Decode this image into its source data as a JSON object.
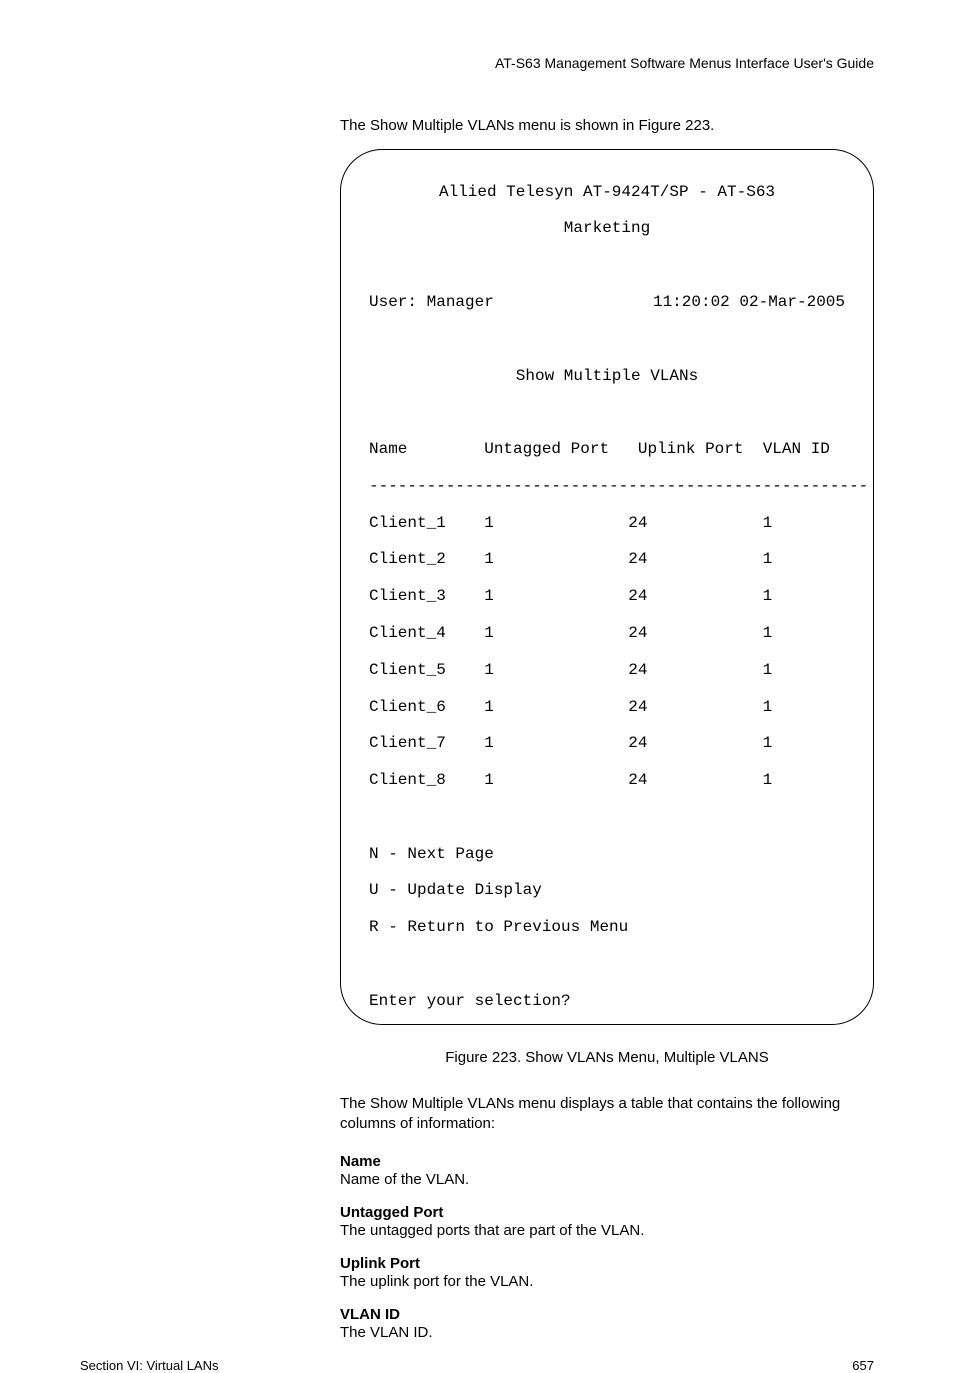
{
  "header": "AT-S63 Management Software Menus Interface User's Guide",
  "intro": "The Show Multiple VLANs menu is shown in Figure 223.",
  "terminal": {
    "title1": "Allied Telesyn AT-9424T/SP - AT-S63",
    "title2": "Marketing",
    "user_label": "User: Manager",
    "timestamp": "11:20:02 02-Mar-2005",
    "screen_title": "Show Multiple VLANs",
    "col_name": "Name",
    "col_untagged": "Untagged Port",
    "col_uplink": "Uplink Port",
    "col_vlan": "VLAN ID",
    "divider": "----------------------------------------------------",
    "rows": [
      {
        "name": "Client_1",
        "untagged": "1",
        "uplink": "24",
        "vlan": "1"
      },
      {
        "name": "Client_2",
        "untagged": "1",
        "uplink": "24",
        "vlan": "1"
      },
      {
        "name": "Client_3",
        "untagged": "1",
        "uplink": "24",
        "vlan": "1"
      },
      {
        "name": "Client_4",
        "untagged": "1",
        "uplink": "24",
        "vlan": "1"
      },
      {
        "name": "Client_5",
        "untagged": "1",
        "uplink": "24",
        "vlan": "1"
      },
      {
        "name": "Client_6",
        "untagged": "1",
        "uplink": "24",
        "vlan": "1"
      },
      {
        "name": "Client_7",
        "untagged": "1",
        "uplink": "24",
        "vlan": "1"
      },
      {
        "name": "Client_8",
        "untagged": "1",
        "uplink": "24",
        "vlan": "1"
      }
    ],
    "nav_n": "N - Next Page",
    "nav_u": "U - Update Display",
    "nav_r": "R - Return to Previous Menu",
    "prompt": "Enter your selection?"
  },
  "caption": "Figure 223. Show VLANs Menu, Multiple VLANS",
  "para": "The Show Multiple VLANs menu displays a table that contains the following columns of information:",
  "def_name_t": "Name",
  "def_name_d": "Name of the VLAN.",
  "def_untagged_t": "Untagged Port",
  "def_untagged_d": "The untagged ports that are part of the VLAN.",
  "def_uplink_t": "Uplink Port",
  "def_uplink_d": "The uplink port for the VLAN.",
  "def_vlan_t": "VLAN ID",
  "def_vlan_d": "The VLAN ID.",
  "footer_left": "Section VI: Virtual LANs",
  "footer_right": "657",
  "chart_data": {
    "type": "table",
    "title": "Show Multiple VLANs",
    "columns": [
      "Name",
      "Untagged Port",
      "Uplink Port",
      "VLAN ID"
    ],
    "rows": [
      [
        "Client_1",
        1,
        24,
        1
      ],
      [
        "Client_2",
        1,
        24,
        1
      ],
      [
        "Client_3",
        1,
        24,
        1
      ],
      [
        "Client_4",
        1,
        24,
        1
      ],
      [
        "Client_5",
        1,
        24,
        1
      ],
      [
        "Client_6",
        1,
        24,
        1
      ],
      [
        "Client_7",
        1,
        24,
        1
      ],
      [
        "Client_8",
        1,
        24,
        1
      ]
    ]
  }
}
